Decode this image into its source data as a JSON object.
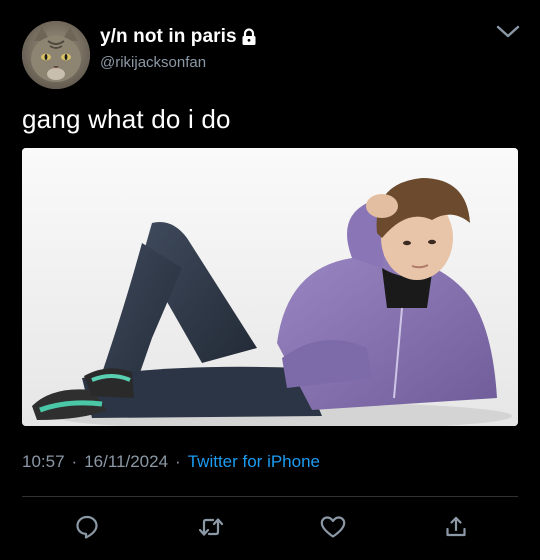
{
  "author": {
    "display_name": "y/n not in paris",
    "handle": "@rikijacksonfan",
    "protected": true,
    "avatar_icon": "cat-avatar"
  },
  "tweet": {
    "text": "gang what do i do",
    "media_description": "photo"
  },
  "meta": {
    "time": "10:57",
    "date": "16/11/2024",
    "source": "Twitter for iPhone",
    "separator": "·"
  },
  "actions": {
    "reply_icon": "reply-icon",
    "retweet_icon": "retweet-icon",
    "like_icon": "heart-icon",
    "share_icon": "share-icon"
  },
  "colors": {
    "background": "#000000",
    "text": "#ffffff",
    "secondary": "#8b98a5",
    "link": "#1d9bf0",
    "divider": "#2f3336"
  }
}
